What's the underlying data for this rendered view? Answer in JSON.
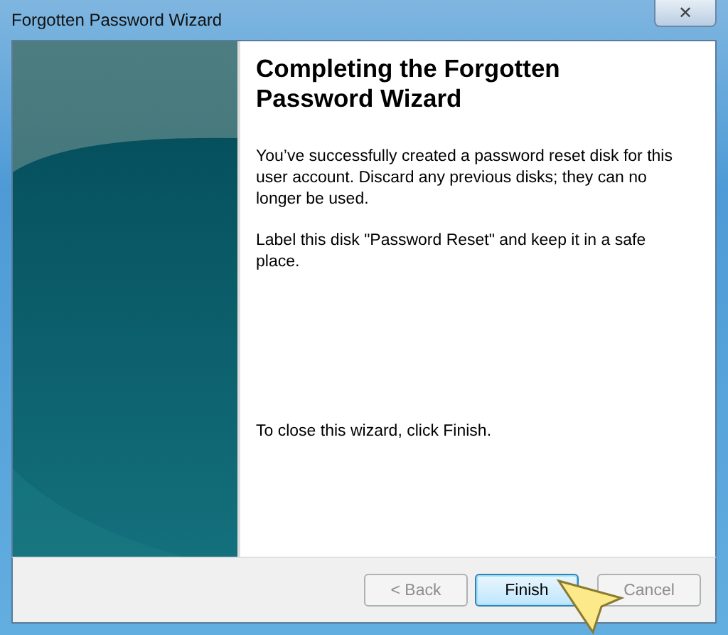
{
  "window": {
    "title": "Forgotten Password Wizard",
    "close_glyph": "✕"
  },
  "heading": "Completing the Forgotten Password Wizard",
  "paragraphs": [
    "You’ve successfully created a password reset disk for this user account. Discard any previous disks; they can no longer be used.",
    "Label this disk \"Password Reset\" and keep it in a safe place."
  ],
  "closing_note": "To close this wizard, click Finish.",
  "buttons": [
    {
      "label": "< Back",
      "disabled": true,
      "default": false
    },
    {
      "label": "Finish",
      "disabled": false,
      "default": true
    },
    {
      "label": "Cancel",
      "disabled": true,
      "default": false
    }
  ]
}
